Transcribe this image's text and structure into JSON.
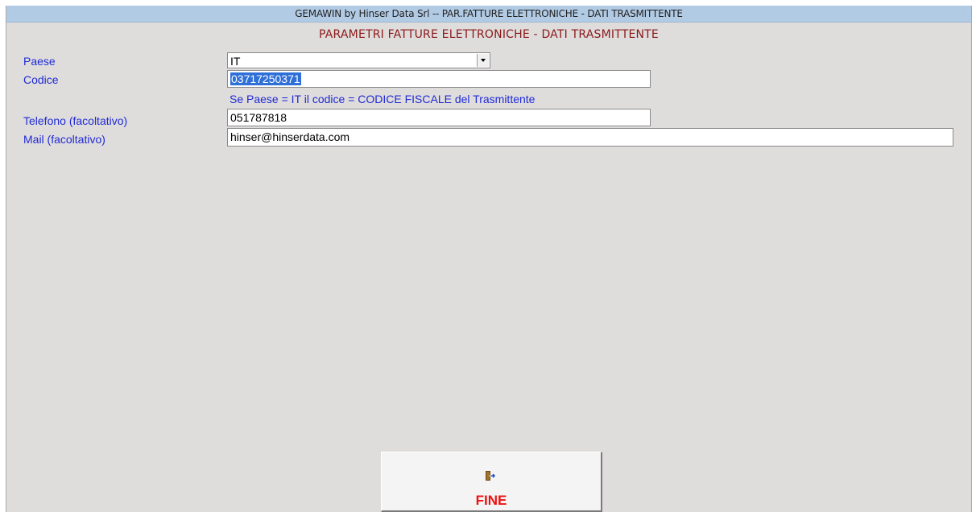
{
  "window": {
    "title": "GEMAWIN by Hinser Data Srl -- PAR.FATTURE ELETTRONICHE - DATI TRASMITTENTE"
  },
  "form": {
    "heading": "PARAMETRI FATTURE ELETTRONICHE - DATI TRASMITTENTE",
    "paese": {
      "label": "Paese",
      "value": "IT"
    },
    "codice": {
      "label": "Codice",
      "value": "03717250371",
      "hint": "Se Paese = IT il codice = CODICE FISCALE del Trasmittente"
    },
    "telefono": {
      "label": "Telefono (facoltativo)",
      "value": "051787818"
    },
    "mail": {
      "label": "Mail (facoltativo)",
      "value": "hinser@hinserdata.com"
    }
  },
  "footer": {
    "fine_label": "FINE",
    "fine_icon": "exit-door-icon"
  },
  "colors": {
    "label_text": "#1f2bd6",
    "heading_text": "#8b1a1a",
    "titlebar_bg": "#b2cbe4",
    "window_bg": "#dfdcdc",
    "fine_text": "#ee1111"
  }
}
